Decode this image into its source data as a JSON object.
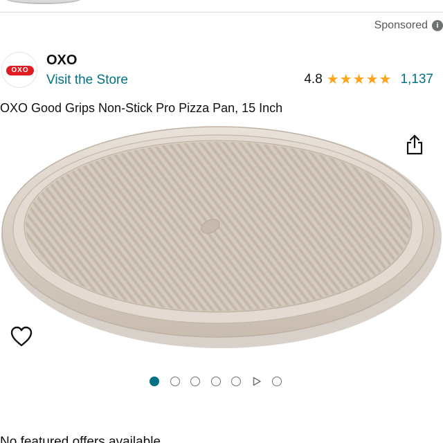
{
  "header": {
    "sponsored_label": "Sponsored",
    "info_icon": "info-icon"
  },
  "brand": {
    "logo_text": "OXO",
    "name": "OXO",
    "visit_store_link": "Visit the Store"
  },
  "rating": {
    "value": "4.8",
    "stars": 4.8,
    "star_icon": "star-icon",
    "count": "1,137"
  },
  "product": {
    "title": "OXO Good Grips Non-Stick Pro Pizza Pan, 15 Inch",
    "image_description_icon": "pizza-pan-image"
  },
  "actions": {
    "share_icon": "share-icon",
    "wishlist_icon": "heart-icon"
  },
  "carousel": {
    "total_slides": 7,
    "active_index": 0,
    "video_slide_index": 5
  },
  "offer": {
    "text": "No featured offers available"
  },
  "colors": {
    "link": "#007185",
    "star": "#ffa41c",
    "brand_red": "#e01b22",
    "text": "#0f1111",
    "muted": "#565959"
  }
}
